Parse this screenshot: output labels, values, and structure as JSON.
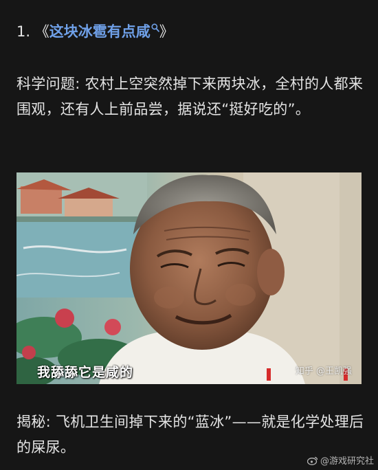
{
  "heading": {
    "number": "1.",
    "open_bracket": "《",
    "link_text": "这块冰雹有点咸",
    "close_bracket": "》"
  },
  "paragraph_1": "科学问题: 农村上空突然掉下来两块冰，全村的人都来围观，还有人上前品尝，据说还“挺好吃的”。",
  "photo": {
    "subtitle": "我舔舔它是咸的",
    "watermark": "知乎 @王凯强"
  },
  "paragraph_2": "揭秘: 飞机卫生间掉下来的“蓝冰”——就是化学处理后的屎尿。",
  "weibo_watermark": "@游戏研究社",
  "colors": {
    "background": "#161616",
    "text": "#e4e4e4",
    "link": "#6fa0e8"
  }
}
